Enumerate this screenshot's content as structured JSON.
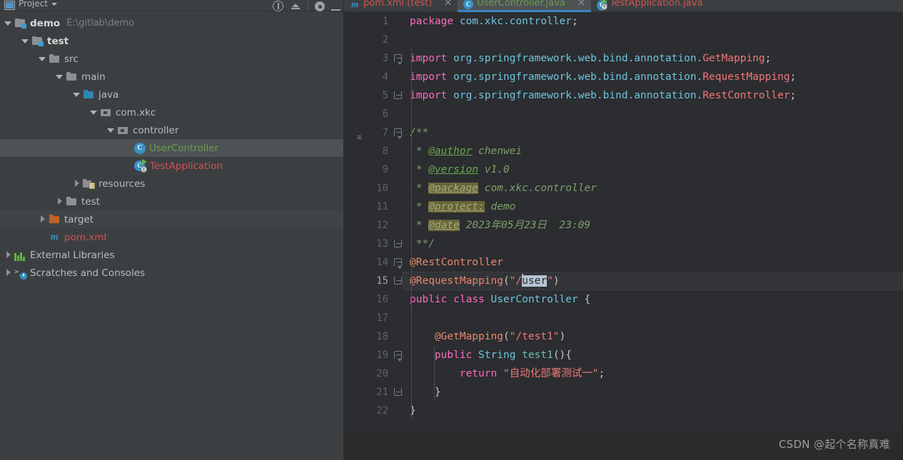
{
  "project_panel": {
    "header": {
      "title": "Project",
      "window_icon": "project-window-icon",
      "caret": "chevron-down-icon",
      "buttons": [
        "info-circle-icon",
        "collapse-all-icon",
        "gear-icon",
        "minimize-icon"
      ]
    },
    "tree": [
      {
        "indent": 0,
        "arrow": "open",
        "icon": "module-icon",
        "label": "demo",
        "style": "bold",
        "path": "E:\\gitlab\\demo",
        "state": "normal"
      },
      {
        "indent": 1,
        "arrow": "open",
        "icon": "module-icon",
        "label": "test",
        "style": "bold",
        "path": "",
        "state": "normal"
      },
      {
        "indent": 2,
        "arrow": "open",
        "icon": "folder-icon",
        "label": "src",
        "style": "plain",
        "path": "",
        "state": "normal"
      },
      {
        "indent": 3,
        "arrow": "open",
        "icon": "folder-icon",
        "label": "main",
        "style": "plain",
        "path": "",
        "state": "normal"
      },
      {
        "indent": 4,
        "arrow": "open",
        "icon": "source-folder-icon",
        "label": "java",
        "style": "plain",
        "path": "",
        "state": "normal"
      },
      {
        "indent": 5,
        "arrow": "open",
        "icon": "package-icon",
        "label": "com.xkc",
        "style": "plain",
        "path": "",
        "state": "normal"
      },
      {
        "indent": 6,
        "arrow": "open",
        "icon": "package-icon",
        "label": "controller",
        "style": "plain",
        "path": "",
        "state": "normal"
      },
      {
        "indent": 7,
        "arrow": "none",
        "icon": "java-class-icon",
        "label": "UserController",
        "style": "green",
        "path": "",
        "state": "selected"
      },
      {
        "indent": 7,
        "arrow": "none",
        "icon": "spring-app-icon",
        "label": "TestApplication",
        "style": "redish",
        "path": "",
        "state": "normal"
      },
      {
        "indent": 4,
        "arrow": "closed",
        "icon": "resources-folder-icon",
        "label": "resources",
        "style": "plain",
        "path": "",
        "state": "normal"
      },
      {
        "indent": 3,
        "arrow": "closed",
        "icon": "folder-icon",
        "label": "test",
        "style": "plain",
        "path": "",
        "state": "normal"
      },
      {
        "indent": 2,
        "arrow": "closed",
        "icon": "excluded-folder-icon",
        "label": "target",
        "style": "plain",
        "path": "",
        "state": "hovered"
      },
      {
        "indent": 2,
        "arrow": "none",
        "icon": "maven-icon",
        "label": "pom.xml",
        "style": "redish",
        "path": "",
        "state": "normal"
      },
      {
        "indent": 0,
        "arrow": "closed",
        "icon": "external-libraries-icon",
        "label": "External Libraries",
        "style": "plain",
        "path": "",
        "state": "normal"
      },
      {
        "indent": 0,
        "arrow": "closed",
        "icon": "scratches-icon",
        "label": "Scratches and Consoles",
        "style": "plain",
        "path": "",
        "state": "normal"
      }
    ]
  },
  "editor": {
    "tabs": [
      {
        "label": "pom.xml (test)",
        "icon": "maven-icon",
        "color": "#d25252",
        "active": false,
        "closable": true
      },
      {
        "label": "UserController.java",
        "icon": "java-class-icon",
        "color": "#6a9c4f",
        "active": true,
        "closable": true
      },
      {
        "label": "TestApplication.java",
        "icon": "spring-app-icon",
        "color": "#d25252",
        "active": false,
        "closable": false
      }
    ],
    "current_line": 15,
    "selection": "user",
    "lines": [
      {
        "n": 1,
        "gutter_icon": "",
        "fold": "",
        "tokens": [
          {
            "t": "package",
            "c": "kw"
          },
          {
            "t": " ",
            "c": "punct"
          },
          {
            "t": "com.xkc.controller",
            "c": "id"
          },
          {
            "t": ";",
            "c": "punct"
          }
        ]
      },
      {
        "n": 2,
        "gutter_icon": "",
        "fold": "",
        "tokens": []
      },
      {
        "n": 3,
        "gutter_icon": "",
        "fold": "top",
        "tokens": [
          {
            "t": "import",
            "c": "kw"
          },
          {
            "t": " ",
            "c": "punct"
          },
          {
            "t": "org.springframework.web.bind.annotation.",
            "c": "id"
          },
          {
            "t": "GetMapping",
            "c": "str"
          },
          {
            "t": ";",
            "c": "punct"
          }
        ]
      },
      {
        "n": 4,
        "gutter_icon": "",
        "fold": "",
        "tokens": [
          {
            "t": "import",
            "c": "kw"
          },
          {
            "t": " ",
            "c": "punct"
          },
          {
            "t": "org.springframework.web.bind.annotation.",
            "c": "id"
          },
          {
            "t": "RequestMapping",
            "c": "str"
          },
          {
            "t": ";",
            "c": "punct"
          }
        ]
      },
      {
        "n": 5,
        "gutter_icon": "",
        "fold": "bot",
        "tokens": [
          {
            "t": "import",
            "c": "kw"
          },
          {
            "t": " ",
            "c": "punct"
          },
          {
            "t": "org.springframework.web.bind.annotation.",
            "c": "id"
          },
          {
            "t": "RestController",
            "c": "str"
          },
          {
            "t": ";",
            "c": "punct"
          }
        ]
      },
      {
        "n": 6,
        "gutter_icon": "",
        "fold": "",
        "tokens": []
      },
      {
        "n": 7,
        "gutter_icon": "",
        "fold": "top",
        "struct": "structure-icon",
        "tokens": [
          {
            "t": "/**",
            "c": "cmt"
          }
        ]
      },
      {
        "n": 8,
        "gutter_icon": "",
        "fold": "",
        "tokens": [
          {
            "t": " * ",
            "c": "cmt"
          },
          {
            "t": "@author",
            "c": "tag"
          },
          {
            "t": " chenwei",
            "c": "cmt"
          }
        ]
      },
      {
        "n": 9,
        "gutter_icon": "",
        "fold": "",
        "tokens": [
          {
            "t": " * ",
            "c": "cmt"
          },
          {
            "t": "@version",
            "c": "tag"
          },
          {
            "t": " v1.0",
            "c": "cmt"
          }
        ]
      },
      {
        "n": 10,
        "gutter_icon": "",
        "fold": "",
        "tokens": [
          {
            "t": " * ",
            "c": "cmt"
          },
          {
            "t": "@package",
            "c": "tag-hl"
          },
          {
            "t": " com.xkc.controller",
            "c": "cmt"
          }
        ]
      },
      {
        "n": 11,
        "gutter_icon": "",
        "fold": "",
        "tokens": [
          {
            "t": " * ",
            "c": "cmt"
          },
          {
            "t": "@project:",
            "c": "tag-hl"
          },
          {
            "t": " demo",
            "c": "cmt"
          }
        ]
      },
      {
        "n": 12,
        "gutter_icon": "",
        "fold": "",
        "tokens": [
          {
            "t": " * ",
            "c": "cmt"
          },
          {
            "t": "@date",
            "c": "tag-hl"
          },
          {
            "t": " 2023年05月23日  23:09",
            "c": "cmt"
          }
        ]
      },
      {
        "n": 13,
        "gutter_icon": "",
        "fold": "bot",
        "tokens": [
          {
            "t": " **/",
            "c": "cmt"
          }
        ]
      },
      {
        "n": 14,
        "gutter_icon": "spring-bean-check-icon",
        "fold": "top",
        "tokens": [
          {
            "t": "@RestController",
            "c": "ann"
          }
        ]
      },
      {
        "n": 15,
        "gutter_icon": "",
        "fold": "bot",
        "tokens": [
          {
            "t": "@RequestMapping",
            "c": "ann"
          },
          {
            "t": "(",
            "c": "punct"
          },
          {
            "t": "\"/",
            "c": "str"
          },
          {
            "t": "user",
            "c": "sel"
          },
          {
            "t": "\"",
            "c": "str"
          },
          {
            "t": ")",
            "c": "punct"
          }
        ]
      },
      {
        "n": 16,
        "gutter_icon": "spring-bean-icon",
        "fold": "",
        "tokens": [
          {
            "t": "public",
            "c": "kw"
          },
          {
            "t": " ",
            "c": "punct"
          },
          {
            "t": "class",
            "c": "kw"
          },
          {
            "t": " ",
            "c": "punct"
          },
          {
            "t": "UserController",
            "c": "id"
          },
          {
            "t": " {",
            "c": "punct"
          }
        ]
      },
      {
        "n": 17,
        "gutter_icon": "",
        "fold": "",
        "tokens": []
      },
      {
        "n": 18,
        "gutter_icon": "",
        "fold": "",
        "tokens": [
          {
            "t": "    ",
            "c": "punct"
          },
          {
            "t": "@GetMapping",
            "c": "ann"
          },
          {
            "t": "(",
            "c": "punct"
          },
          {
            "t": "\"/test1\"",
            "c": "str"
          },
          {
            "t": ")",
            "c": "punct"
          }
        ]
      },
      {
        "n": 19,
        "gutter_icon": "spring-bean-icon",
        "fold": "top",
        "tokens": [
          {
            "t": "    ",
            "c": "punct"
          },
          {
            "t": "public",
            "c": "kw"
          },
          {
            "t": " ",
            "c": "punct"
          },
          {
            "t": "String",
            "c": "id"
          },
          {
            "t": " ",
            "c": "punct"
          },
          {
            "t": "test1",
            "c": "mth"
          },
          {
            "t": "(){",
            "c": "punct"
          }
        ]
      },
      {
        "n": 20,
        "gutter_icon": "",
        "fold": "",
        "tokens": [
          {
            "t": "        ",
            "c": "punct"
          },
          {
            "t": "return",
            "c": "kw"
          },
          {
            "t": " ",
            "c": "punct"
          },
          {
            "t": "\"自动化部署测试一\"",
            "c": "str"
          },
          {
            "t": ";",
            "c": "punct"
          }
        ]
      },
      {
        "n": 21,
        "gutter_icon": "",
        "fold": "bot",
        "tokens": [
          {
            "t": "    }",
            "c": "punct"
          }
        ]
      },
      {
        "n": 22,
        "gutter_icon": "",
        "fold": "",
        "tokens": [
          {
            "t": "}",
            "c": "punct"
          }
        ]
      }
    ]
  },
  "watermark": "CSDN @起个名称真难"
}
